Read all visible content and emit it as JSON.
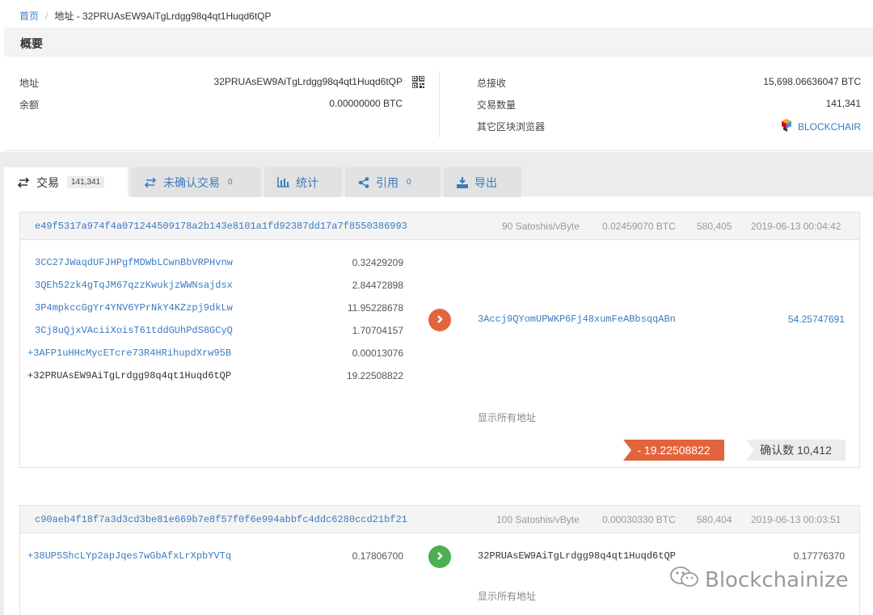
{
  "breadcrumb": {
    "home": "首页",
    "separator": "/",
    "current": "地址 - 32PRUAsEW9AiTgLrdgg98q4qt1Huqd6tQP"
  },
  "overview": {
    "title": "概要",
    "address_label": "地址",
    "address_value": "32PRUAsEW9AiTgLrdgg98q4qt1Huqd6tQP",
    "balance_label": "余额",
    "balance_value": "0.00000000 BTC",
    "total_received_label": "总接收",
    "total_received_value": "15,698.06636047 BTC",
    "tx_count_label": "交易数量",
    "tx_count_value": "141,341",
    "explorers_label": "其它区块浏览器",
    "explorer_link": "BLOCKCHAIR"
  },
  "tabs": [
    {
      "label": "交易",
      "count": "141,341",
      "icon": "swap-icon"
    },
    {
      "label": "未确认交易",
      "count": "0",
      "icon": "swap-icon"
    },
    {
      "label": "统计",
      "count": "",
      "icon": "bar-chart-icon"
    },
    {
      "label": "引用",
      "count": "0",
      "icon": "share-icon"
    },
    {
      "label": "导出",
      "count": "",
      "icon": "download-icon"
    }
  ],
  "transactions": [
    {
      "hash": "e49f5317a974f4a071244509178a2b143e8101a1fd92387dd17a7f8550386993",
      "fee_rate": "90 Satoshis/vByte",
      "fee": "0.02459070 BTC",
      "block": "580,405",
      "time": "2019-06-13 00:04:42",
      "inputs": [
        {
          "address": "3CC27JWaqdUFJHPgfMDWbLCwnBbVRPHvnw",
          "amount": "0.32429209"
        },
        {
          "address": "3QEh52zk4gTqJM67qzzKwukjzWWNsajdsx",
          "amount": "2.84472898"
        },
        {
          "address": "3P4mpkccGgYr4YNV6YPrNkY4KZzpj9dkLw",
          "amount": "11.95228678"
        },
        {
          "address": "3Cj8uQjxVAciiXoisT61tddGUhPdS8GCyQ",
          "amount": "1.70704157"
        },
        {
          "address": "+3AFP1uHHcMycETcre73R4HRihupdXrw95B",
          "amount": "0.00013076"
        },
        {
          "address": "+32PRUAsEW9AiTgLrdgg98q4qt1Huqd6tQP",
          "amount": "19.22508822"
        }
      ],
      "outputs": [
        {
          "address": "3Accj9QYomUPWKP6Fj48xumFeABbsqqABn",
          "amount": "54.25747691"
        }
      ],
      "show_all": "显示所有地址",
      "net_change": "- 19.22508822",
      "confirmations": "确认数 10,412",
      "direction_color": "#e3643c"
    },
    {
      "hash": "c90aeb4f18f7a3d3cd3be81e669b7e8f57f0f6e994abbfc4ddc6280ccd21bf21",
      "fee_rate": "100 Satoshis/vByte",
      "fee": "0.00030330 BTC",
      "block": "580,404",
      "time": "2019-06-13 00:03:51",
      "inputs": [
        {
          "address": "+38UP5ShcLYp2apJqes7wGbAfxLrXpbYVTq",
          "amount": "0.17806700"
        }
      ],
      "outputs": [
        {
          "address": "32PRUAsEW9AiTgLrdgg98q4qt1Huqd6tQP",
          "amount": "0.17776370"
        }
      ],
      "show_all": "显示所有地址",
      "direction_color": "#4caf50"
    }
  ],
  "watermark": "Blockchainize"
}
